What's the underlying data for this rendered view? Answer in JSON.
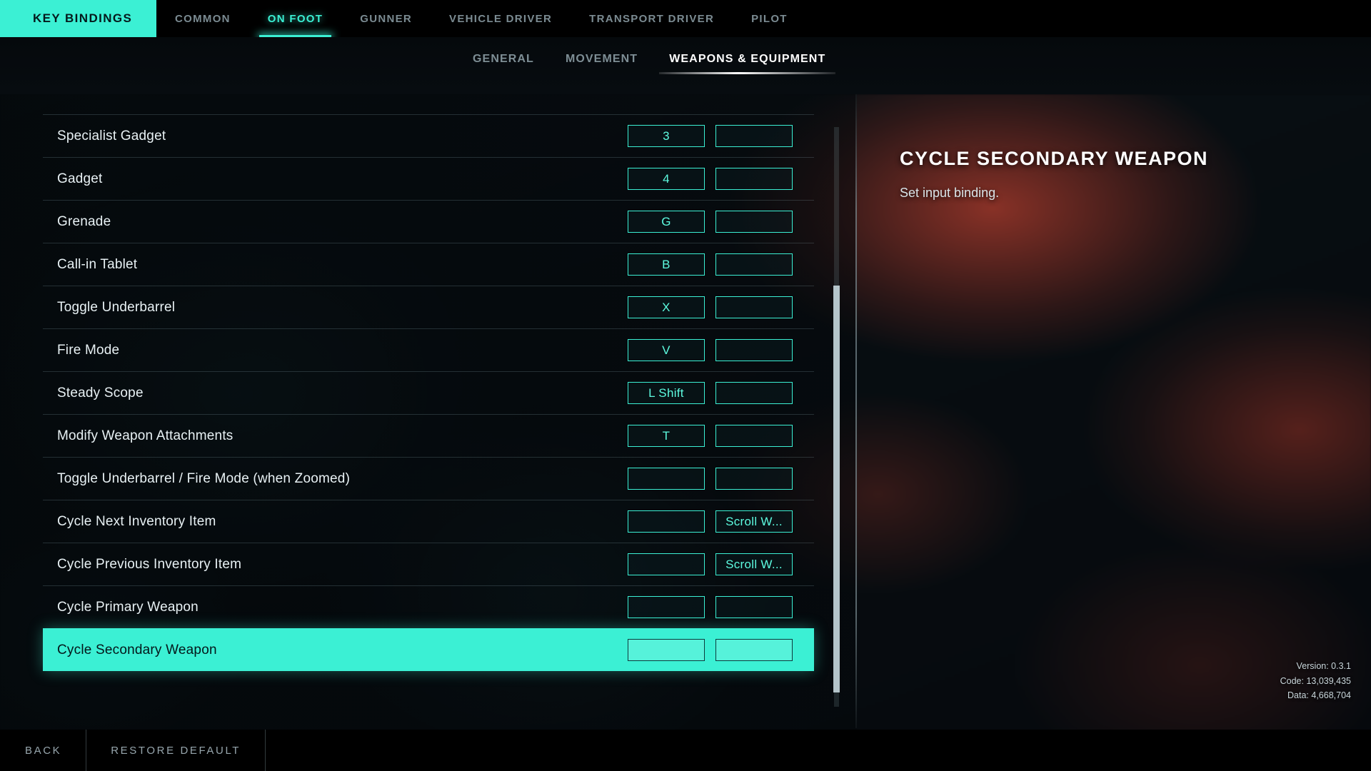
{
  "topbar": {
    "key_bindings_label": "KEY BINDINGS",
    "tabs": [
      {
        "label": "COMMON",
        "active": false
      },
      {
        "label": "ON FOOT",
        "active": true
      },
      {
        "label": "GUNNER",
        "active": false
      },
      {
        "label": "VEHICLE DRIVER",
        "active": false
      },
      {
        "label": "TRANSPORT DRIVER",
        "active": false
      },
      {
        "label": "PILOT",
        "active": false
      }
    ]
  },
  "subtabs": [
    {
      "label": "GENERAL",
      "active": false
    },
    {
      "label": "MOVEMENT",
      "active": false
    },
    {
      "label": "WEAPONS & EQUIPMENT",
      "active": true
    }
  ],
  "bindings": [
    {
      "label": "Specialist Gadget",
      "primary": "3",
      "secondary": "",
      "selected": false
    },
    {
      "label": "Gadget",
      "primary": "4",
      "secondary": "",
      "selected": false
    },
    {
      "label": "Grenade",
      "primary": "G",
      "secondary": "",
      "selected": false
    },
    {
      "label": "Call-in Tablet",
      "primary": "B",
      "secondary": "",
      "selected": false
    },
    {
      "label": "Toggle Underbarrel",
      "primary": "X",
      "secondary": "",
      "selected": false
    },
    {
      "label": "Fire Mode",
      "primary": "V",
      "secondary": "",
      "selected": false
    },
    {
      "label": "Steady Scope",
      "primary": "L Shift",
      "secondary": "",
      "selected": false
    },
    {
      "label": "Modify Weapon Attachments",
      "primary": "T",
      "secondary": "",
      "selected": false
    },
    {
      "label": "Toggle Underbarrel / Fire Mode (when Zoomed)",
      "primary": "",
      "secondary": "",
      "selected": false
    },
    {
      "label": "Cycle Next Inventory Item",
      "primary": "",
      "secondary": "Scroll W...",
      "selected": false
    },
    {
      "label": "Cycle Previous Inventory Item",
      "primary": "",
      "secondary": "Scroll W...",
      "selected": false
    },
    {
      "label": "Cycle Primary Weapon",
      "primary": "",
      "secondary": "",
      "selected": false
    },
    {
      "label": "Cycle Secondary Weapon",
      "primary": "",
      "secondary": "",
      "selected": true
    }
  ],
  "detail": {
    "title": "CYCLE SECONDARY WEAPON",
    "description": "Set input binding."
  },
  "version_info": {
    "version": "Version: 0.3.1",
    "code": "Code: 13,039,435",
    "data": "Data: 4,668,704"
  },
  "bottombar": {
    "back_label": "BACK",
    "restore_default_label": "RESTORE DEFAULT"
  },
  "colors": {
    "accent": "#3bf0d4",
    "accent_text": "#5dfbe0",
    "background": "#05080b",
    "row_text": "#e8f1f4"
  }
}
